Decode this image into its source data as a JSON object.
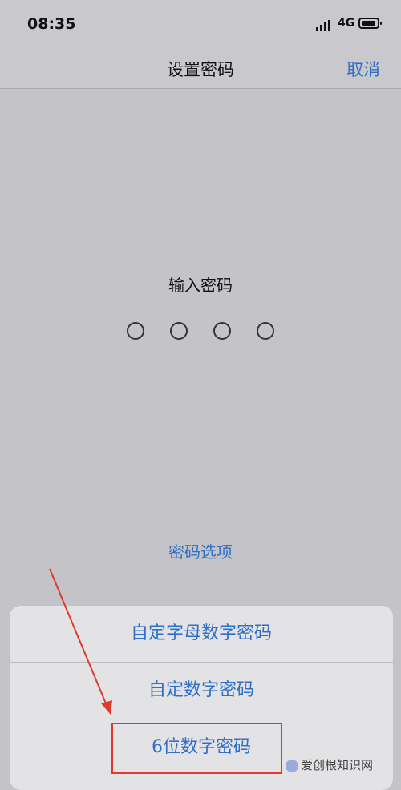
{
  "status_bar": {
    "time": "08:35",
    "network": "4G"
  },
  "nav": {
    "title": "设置密码",
    "cancel_label": "取消"
  },
  "main": {
    "prompt": "输入密码",
    "passcode_length": 4,
    "options_link": "密码选项"
  },
  "sheet": {
    "options": [
      {
        "label": "自定字母数字密码"
      },
      {
        "label": "自定数字密码"
      },
      {
        "label": "6位数字密码"
      }
    ]
  },
  "annotation": {
    "color": "#e0392e"
  },
  "watermark": {
    "text": "爱创根知识网"
  }
}
